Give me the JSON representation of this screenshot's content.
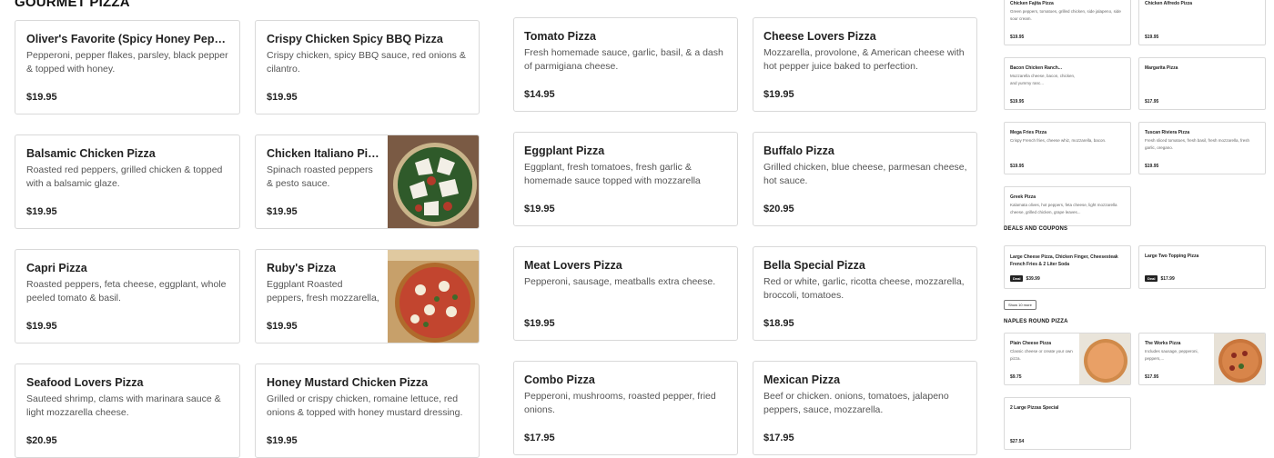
{
  "section_title": "GOURMET PIZZA",
  "left_items": [
    {
      "name": "Oliver's Favorite (Spicy Honey Pepperoni) Pizza",
      "desc": "Pepperoni, pepper flakes, parsley, black pepper & topped with honey.",
      "price": "$19.95"
    },
    {
      "name": "Crispy Chicken Spicy BBQ Pizza",
      "desc": "Crispy chicken, spicy BBQ sauce, red onions & cilantro.",
      "price": "$19.95"
    },
    {
      "name": "Balsamic Chicken Pizza",
      "desc": "Roasted red peppers, grilled chicken & topped with a balsamic glaze.",
      "price": "$19.95"
    },
    {
      "name": "Chicken Italiano Pizza",
      "desc": "Spinach roasted peppers & pesto sauce.",
      "price": "$19.95"
    },
    {
      "name": "Capri Pizza",
      "desc": "Roasted peppers, feta cheese, eggplant, whole peeled tomato & basil.",
      "price": "$19.95"
    },
    {
      "name": "Ruby's Pizza",
      "desc": "Eggplant Roasted peppers, fresh mozzarella, whole...",
      "price": "$19.95"
    },
    {
      "name": "Seafood Lovers Pizza",
      "desc": "Sauteed shrimp, clams with marinara sauce & light mozzarella cheese.",
      "price": "$20.95"
    },
    {
      "name": "Honey Mustard Chicken Pizza",
      "desc": "Grilled or crispy chicken, romaine lettuce, red onions & topped with honey mustard dressing.",
      "price": "$19.95"
    }
  ],
  "mid_items": [
    {
      "name": "Tomato Pizza",
      "desc": "Fresh homemade sauce, garlic, basil, & a dash of parmigiana cheese.",
      "price": "$14.95"
    },
    {
      "name": "Cheese Lovers Pizza",
      "desc": "Mozzarella, provolone, & American cheese with hot pepper juice baked to perfection.",
      "price": "$19.95"
    },
    {
      "name": "Eggplant Pizza",
      "desc": "Eggplant, fresh tomatoes, fresh garlic & homemade sauce topped with mozzarella cheese.",
      "price": "$19.95"
    },
    {
      "name": "Buffalo Pizza",
      "desc": "Grilled chicken, blue cheese, parmesan cheese, hot sauce.",
      "price": "$20.95"
    },
    {
      "name": "Meat Lovers Pizza",
      "desc": "Pepperoni, sausage, meatballs extra cheese.",
      "price": "$19.95"
    },
    {
      "name": "Bella Special Pizza",
      "desc": "Red or white, garlic, ricotta cheese, mozzarella, broccoli, tomatoes.",
      "price": "$18.95"
    },
    {
      "name": "Combo Pizza",
      "desc": "Pepperoni, mushrooms, roasted pepper, fried onions.",
      "price": "$17.95"
    },
    {
      "name": "Mexican Pizza",
      "desc": "Beef or chicken. onions, tomatoes, jalapeno peppers, sauce, mozzarella.",
      "price": "$17.95"
    }
  ],
  "right_items": [
    {
      "name": "Chicken Fajita Pizza",
      "desc": "Green peppers, tomatoes, grilled chicken, side jalapeno, side sour cream.",
      "price": "$19.95"
    },
    {
      "name": "Chicken Alfredo Pizza",
      "desc": "",
      "price": "$19.95"
    },
    {
      "name": "Bacon Chicken Ranch...",
      "desc": "Mozzarella cheese, bacon, chicken, and yummy ranc...",
      "price": "$19.95"
    },
    {
      "name": "Margarita Pizza",
      "desc": "",
      "price": "$17.95"
    },
    {
      "name": "Mega Fries Pizza",
      "desc": "Crispy French fries, cheese whiz, mozzarella, bacon.",
      "price": "$19.95"
    },
    {
      "name": "Tuscan Riviera Pizza",
      "desc": "Fresh sliced tomatoes, fresh basil, fresh mozzarella, fresh garlic, oregano.",
      "price": "$19.95"
    },
    {
      "name": "Greek Pizza",
      "desc": "Kalamata olives, hot peppers, feta cheese, light mozzarella cheese, grilled chicken, grape leaves...",
      "price": ""
    }
  ],
  "deals": {
    "title": "DEALS AND COUPONS",
    "badge": "Deal",
    "items": [
      {
        "name": "Large Cheese Pizza, Chicken Finger, Cheesesteak French Fries & 2 Liter Soda",
        "price": "$39.99"
      },
      {
        "name": "Large Two Topping Pizza",
        "price": "$17.99"
      }
    ],
    "show_more": "Show 10 more"
  },
  "naples": {
    "title": "NAPLES ROUND PIZZA",
    "items": [
      {
        "name": "Plain Cheese Pizza",
        "desc": "Classic cheese or create your own pizza.",
        "price": "$9.75"
      },
      {
        "name": "The Works Pizza",
        "desc": "Includes sausage, pepperoni, peppers,...",
        "price": "$17.95"
      },
      {
        "name": "2 Large Pizzas Special",
        "desc": "",
        "price": "$27.54"
      }
    ]
  }
}
